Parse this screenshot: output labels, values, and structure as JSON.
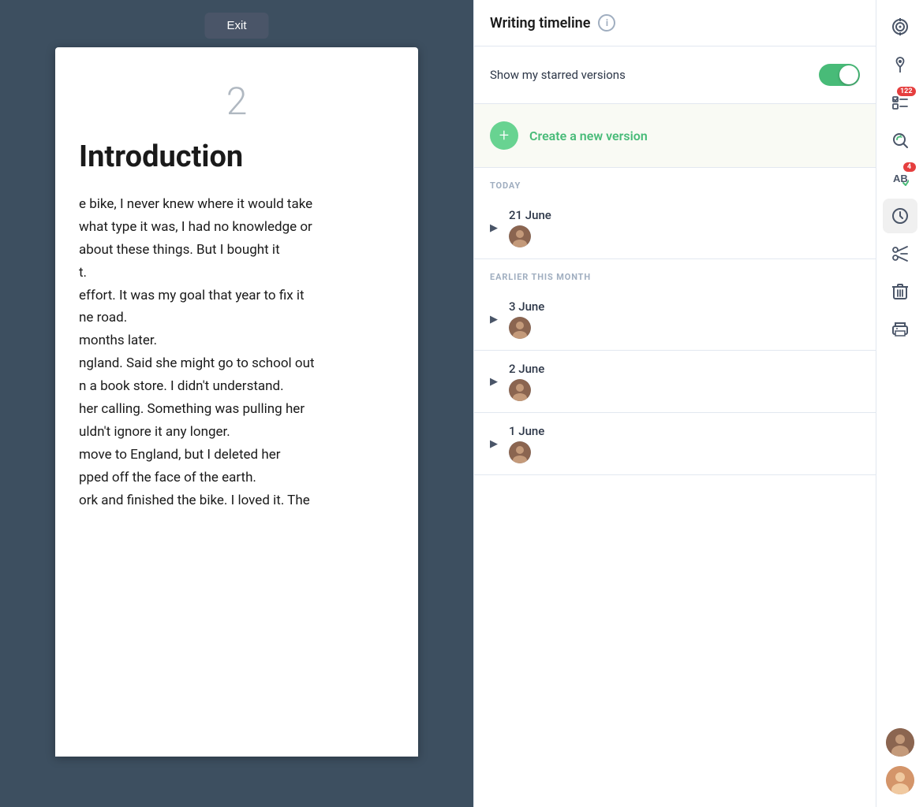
{
  "exit_button": "Exit",
  "page_number": "2",
  "doc_title": "Introduction",
  "doc_text": "e bike, I never knew where it would take\nwhat type it was, I had no knowledge or\nabout these things. But I bought it\nt.\neffort. It was my goal that year to fix it\nne road.\nmonths later.\nngland. Said she might go to school out\nn a book store. I didn't understand.\nher calling. Something was pulling her\nuldn't ignore it any longer.\nmove to England, but I deleted her\npped off the face of the earth.\nork and finished the bike. I loved it. The",
  "timeline": {
    "title": "Writing timeline",
    "info_label": "i",
    "starred_label": "Show my starred versions",
    "toggle_on": true,
    "create_label": "Create a new version",
    "sections": [
      {
        "label": "TODAY",
        "entries": [
          {
            "date": "21 June",
            "has_avatar": true
          }
        ]
      },
      {
        "label": "EARLIER THIS MONTH",
        "entries": [
          {
            "date": "3 June",
            "has_avatar": true
          },
          {
            "date": "2 June",
            "has_avatar": true
          },
          {
            "date": "1 June",
            "has_avatar": true
          }
        ]
      }
    ]
  },
  "toolbar": {
    "icons": [
      {
        "name": "target-icon",
        "symbol": "◎",
        "badge": null,
        "active": false
      },
      {
        "name": "pin-icon",
        "symbol": "📌",
        "badge": null,
        "active": false
      },
      {
        "name": "checklist-icon",
        "symbol": "✔",
        "badge": "122",
        "active": false
      },
      {
        "name": "search-icon",
        "symbol": "⟳",
        "badge": null,
        "active": false
      },
      {
        "name": "spellcheck-icon",
        "symbol": "AB",
        "badge": "4",
        "active": false
      },
      {
        "name": "history-icon",
        "symbol": "🕐",
        "badge": null,
        "active": true
      },
      {
        "name": "scissors-icon",
        "symbol": "✂",
        "badge": null,
        "active": false
      },
      {
        "name": "trash-icon",
        "symbol": "🗑",
        "badge": null,
        "active": false
      },
      {
        "name": "print-icon",
        "symbol": "⊟",
        "badge": null,
        "active": false
      }
    ],
    "avatars": [
      {
        "name": "user-avatar-1",
        "color": "#8B5E3C"
      },
      {
        "name": "user-avatar-2",
        "color": "#E8A87C"
      }
    ]
  }
}
